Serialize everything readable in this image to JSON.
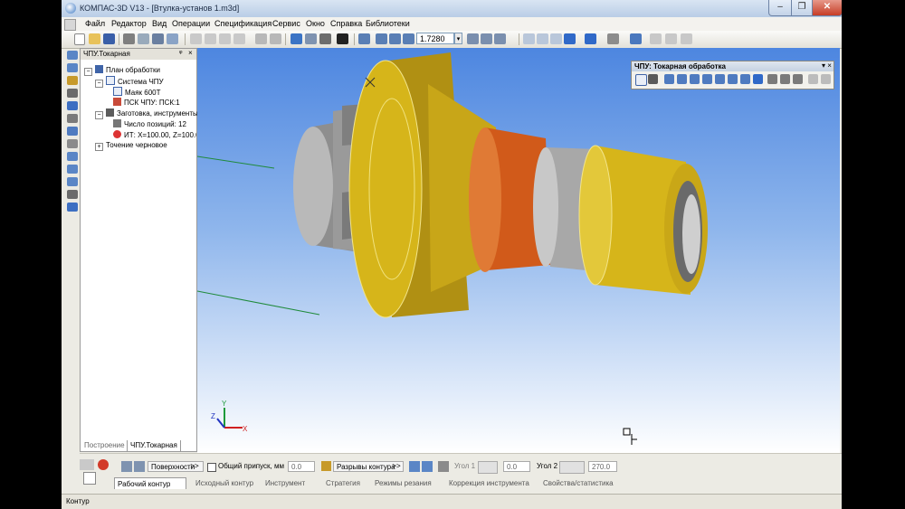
{
  "window": {
    "title": "КОМПАС-3D V13 - [Втулка-установ 1.m3d]",
    "min_glyph": "–",
    "max_glyph": "❐",
    "close_glyph": "✕"
  },
  "menu": [
    "Файл",
    "Редактор",
    "Вид",
    "Операции",
    "Спецификация",
    "Сервис",
    "Окно",
    "Справка",
    "Библиотеки"
  ],
  "toolbar": {
    "zoom_value": "1.7280",
    "zoom_arrow": "▾"
  },
  "tree": {
    "panel_title": "ЧПУ.Токарная",
    "pin_glyph": "ᵠ",
    "close_glyph": "×",
    "nodes": [
      {
        "label": "План обработки",
        "expander": "−"
      },
      {
        "label": "Система ЧПУ",
        "expander": "−"
      },
      {
        "label": "Маяк 600Т",
        "expander": ""
      },
      {
        "label": "ПСК ЧПУ: ПСК:1",
        "expander": ""
      },
      {
        "label": "Заготовка, инструменты",
        "expander": "−"
      },
      {
        "label": "Число позиций: 12",
        "expander": ""
      },
      {
        "label": "ИТ: X=100.00, Z=100.0",
        "expander": ""
      },
      {
        "label": "Точение черновое",
        "expander": "+"
      }
    ],
    "tabs": [
      "Построение",
      "ЧПУ.Токарная"
    ]
  },
  "cnc_panel": {
    "title": "ЧПУ: Токарная обработка",
    "close_glyph": "▾ ×"
  },
  "axes": {
    "x": "X",
    "y": "Y",
    "z": "Z"
  },
  "properties": {
    "surfaces_label": "Поверхности",
    "surfaces_more": ">>",
    "allowance_label": "Общий припуск, мм",
    "allowance_value": "0.0",
    "breaks_label": "Разрывы контура",
    "breaks_more": ">>",
    "angle1_label": "Угол 1",
    "angle1_value": "0.0",
    "angle2_label": "Угол 2",
    "angle2_value": "270.0",
    "tabs": [
      "Рабочий контур",
      "Исходный контур",
      "Инструмент",
      "Стратегия",
      "Режимы резания",
      "Коррекция инструмента",
      "Свойства/статистика"
    ]
  },
  "status": {
    "text": "Контур"
  },
  "colors": {
    "model_yellow": "#d6b51a",
    "model_orange": "#d8641f",
    "model_grey": "#9c9c9c",
    "viewport_top": "#4d86e0"
  }
}
